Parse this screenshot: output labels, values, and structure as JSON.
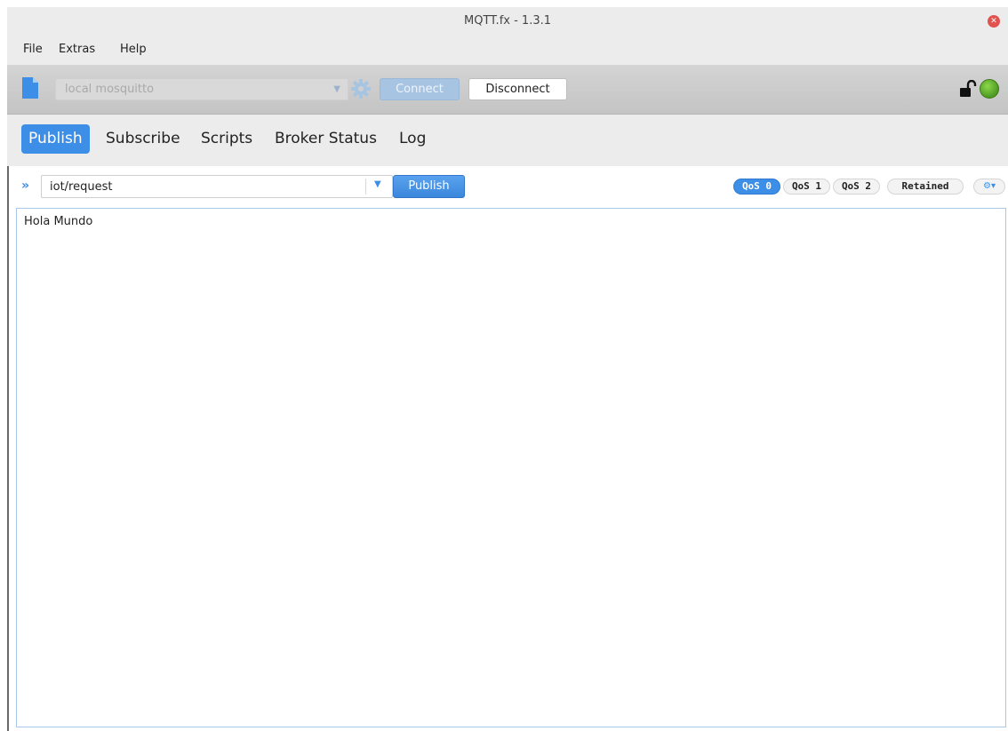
{
  "window": {
    "title": "MQTT.fx - 1.3.1"
  },
  "menu": {
    "items": [
      "File",
      "Extras",
      "Help"
    ]
  },
  "connection": {
    "profile": "local mosquitto",
    "connect_label": "Connect",
    "disconnect_label": "Disconnect",
    "connected": true,
    "status_color": "#5db22a"
  },
  "tabs": [
    {
      "label": "Publish",
      "active": true
    },
    {
      "label": "Subscribe",
      "active": false
    },
    {
      "label": "Scripts",
      "active": false
    },
    {
      "label": "Broker Status",
      "active": false
    },
    {
      "label": "Log",
      "active": false
    }
  ],
  "publish": {
    "topic": "iot/request",
    "publish_label": "Publish",
    "qos": [
      {
        "label": "QoS 0",
        "selected": true
      },
      {
        "label": "QoS 1",
        "selected": false
      },
      {
        "label": "QoS 2",
        "selected": false
      }
    ],
    "retained_label": "Retained",
    "retained": false,
    "payload": "Hola Mundo"
  },
  "colors": {
    "accent": "#3d8ee6",
    "toolbar": "#c8c8c8"
  }
}
